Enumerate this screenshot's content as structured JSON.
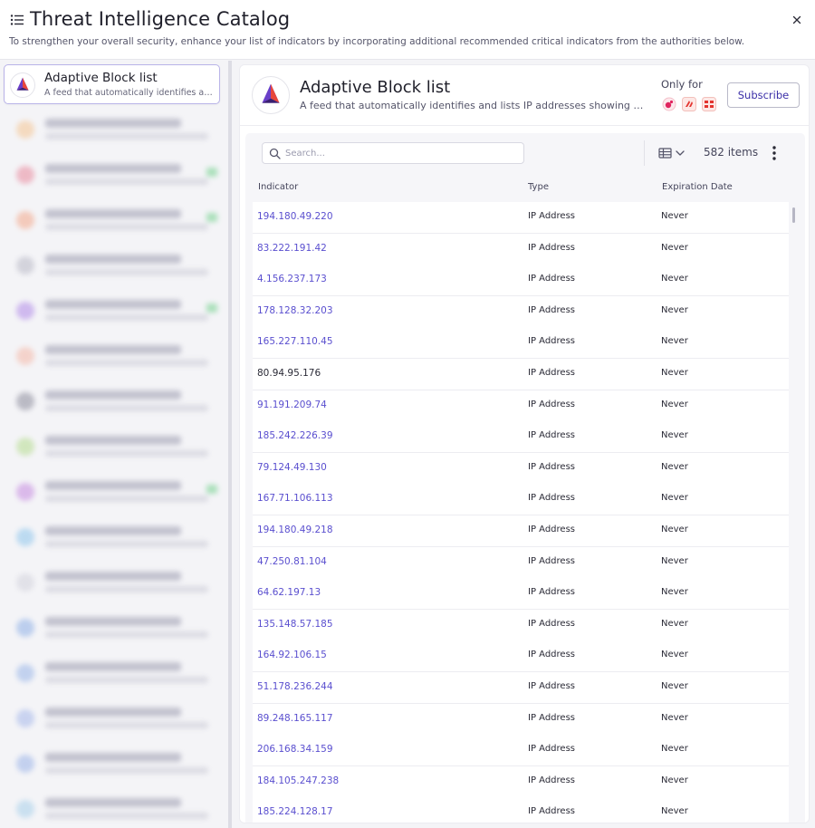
{
  "header": {
    "title": "Threat Intelligence Catalog",
    "subtitle": "To strengthen your overall security, enhance your list of indicators by incorporating additional recommended critical indicators from the authorities below."
  },
  "sidebar": {
    "active_item": {
      "name": "Adaptive Block list",
      "description": "A feed that automatically identifies and lists IP addresses showing suspicious activity"
    },
    "blurred_item_colors": [
      "#f5c592",
      "#e98a9e",
      "#f3a88b",
      "#b9b9c6",
      "#b18ae8",
      "#f5b8a8",
      "#8c8c9c",
      "#b5dc8f",
      "#c68ae0",
      "#8fc6ec",
      "#d2d2dc",
      "#8fb0e6",
      "#9ab6e8",
      "#a6b8ea",
      "#9cb4e8",
      "#a8d0ea"
    ],
    "blurred_item_tags": [
      false,
      true,
      true,
      false,
      true,
      false,
      false,
      false,
      true,
      false,
      false,
      false,
      false,
      false,
      false,
      false
    ]
  },
  "detail": {
    "name": "Adaptive Block list",
    "description": "A feed that automatically identifies and lists IP addresses showing suspicious activity",
    "only_for_label": "Only for",
    "subscribe_label": "Subscribe",
    "vendor_icons": [
      "brand-a-icon",
      "brand-b-icon",
      "brand-c-icon"
    ]
  },
  "table": {
    "search_placeholder": "Search...",
    "items_count": "582 items",
    "columns": [
      "Indicator",
      "Type",
      "Expiration Date"
    ],
    "rows": [
      {
        "indicator": "194.180.49.220",
        "type": "IP Address",
        "expiration": "Never",
        "link": true
      },
      {
        "indicator": "83.222.191.42",
        "type": "IP Address",
        "expiration": "Never",
        "link": true
      },
      {
        "indicator": "4.156.237.173",
        "type": "IP Address",
        "expiration": "Never",
        "link": true
      },
      {
        "indicator": "178.128.32.203",
        "type": "IP Address",
        "expiration": "Never",
        "link": true
      },
      {
        "indicator": "165.227.110.45",
        "type": "IP Address",
        "expiration": "Never",
        "link": true
      },
      {
        "indicator": "80.94.95.176",
        "type": "IP Address",
        "expiration": "Never",
        "link": false
      },
      {
        "indicator": "91.191.209.74",
        "type": "IP Address",
        "expiration": "Never",
        "link": true
      },
      {
        "indicator": "185.242.226.39",
        "type": "IP Address",
        "expiration": "Never",
        "link": true
      },
      {
        "indicator": "79.124.49.130",
        "type": "IP Address",
        "expiration": "Never",
        "link": true
      },
      {
        "indicator": "167.71.106.113",
        "type": "IP Address",
        "expiration": "Never",
        "link": true
      },
      {
        "indicator": "194.180.49.218",
        "type": "IP Address",
        "expiration": "Never",
        "link": true
      },
      {
        "indicator": "47.250.81.104",
        "type": "IP Address",
        "expiration": "Never",
        "link": true
      },
      {
        "indicator": "64.62.197.13",
        "type": "IP Address",
        "expiration": "Never",
        "link": true
      },
      {
        "indicator": "135.148.57.185",
        "type": "IP Address",
        "expiration": "Never",
        "link": true
      },
      {
        "indicator": "164.92.106.15",
        "type": "IP Address",
        "expiration": "Never",
        "link": true
      },
      {
        "indicator": "51.178.236.244",
        "type": "IP Address",
        "expiration": "Never",
        "link": true
      },
      {
        "indicator": "89.248.165.117",
        "type": "IP Address",
        "expiration": "Never",
        "link": true
      },
      {
        "indicator": "206.168.34.159",
        "type": "IP Address",
        "expiration": "Never",
        "link": true
      },
      {
        "indicator": "184.105.247.238",
        "type": "IP Address",
        "expiration": "Never",
        "link": true
      },
      {
        "indicator": "185.224.128.17",
        "type": "IP Address",
        "expiration": "Never",
        "link": true
      }
    ]
  },
  "colors": {
    "accent": "#5a4fcf",
    "subscribe_text": "#3b2fa8",
    "active_border": "#b9b3e8"
  }
}
